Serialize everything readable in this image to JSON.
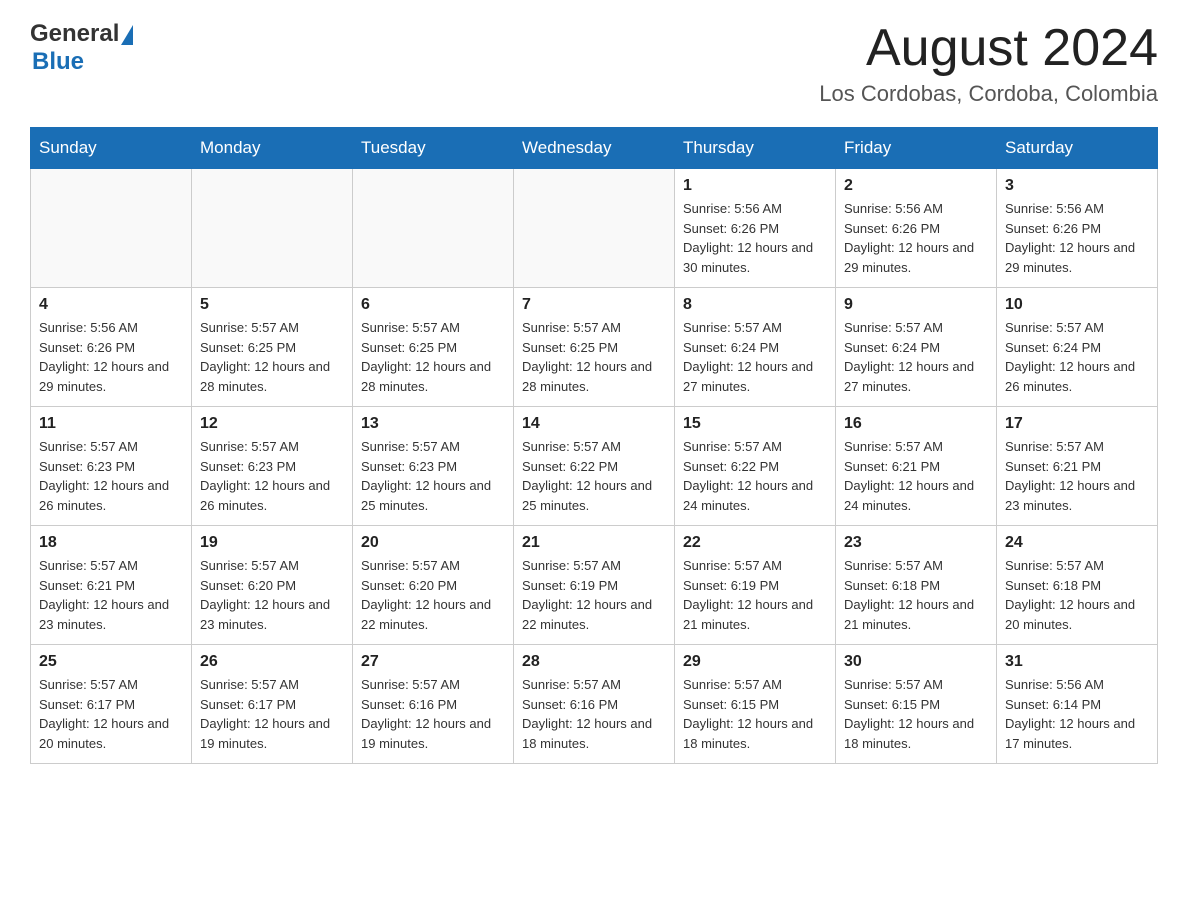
{
  "header": {
    "logo": {
      "general": "General",
      "blue": "Blue"
    },
    "title": "August 2024",
    "location": "Los Cordobas, Cordoba, Colombia"
  },
  "days_of_week": [
    "Sunday",
    "Monday",
    "Tuesday",
    "Wednesday",
    "Thursday",
    "Friday",
    "Saturday"
  ],
  "weeks": [
    [
      {
        "day": "",
        "info": ""
      },
      {
        "day": "",
        "info": ""
      },
      {
        "day": "",
        "info": ""
      },
      {
        "day": "",
        "info": ""
      },
      {
        "day": "1",
        "info": "Sunrise: 5:56 AM\nSunset: 6:26 PM\nDaylight: 12 hours and 30 minutes."
      },
      {
        "day": "2",
        "info": "Sunrise: 5:56 AM\nSunset: 6:26 PM\nDaylight: 12 hours and 29 minutes."
      },
      {
        "day": "3",
        "info": "Sunrise: 5:56 AM\nSunset: 6:26 PM\nDaylight: 12 hours and 29 minutes."
      }
    ],
    [
      {
        "day": "4",
        "info": "Sunrise: 5:56 AM\nSunset: 6:26 PM\nDaylight: 12 hours and 29 minutes."
      },
      {
        "day": "5",
        "info": "Sunrise: 5:57 AM\nSunset: 6:25 PM\nDaylight: 12 hours and 28 minutes."
      },
      {
        "day": "6",
        "info": "Sunrise: 5:57 AM\nSunset: 6:25 PM\nDaylight: 12 hours and 28 minutes."
      },
      {
        "day": "7",
        "info": "Sunrise: 5:57 AM\nSunset: 6:25 PM\nDaylight: 12 hours and 28 minutes."
      },
      {
        "day": "8",
        "info": "Sunrise: 5:57 AM\nSunset: 6:24 PM\nDaylight: 12 hours and 27 minutes."
      },
      {
        "day": "9",
        "info": "Sunrise: 5:57 AM\nSunset: 6:24 PM\nDaylight: 12 hours and 27 minutes."
      },
      {
        "day": "10",
        "info": "Sunrise: 5:57 AM\nSunset: 6:24 PM\nDaylight: 12 hours and 26 minutes."
      }
    ],
    [
      {
        "day": "11",
        "info": "Sunrise: 5:57 AM\nSunset: 6:23 PM\nDaylight: 12 hours and 26 minutes."
      },
      {
        "day": "12",
        "info": "Sunrise: 5:57 AM\nSunset: 6:23 PM\nDaylight: 12 hours and 26 minutes."
      },
      {
        "day": "13",
        "info": "Sunrise: 5:57 AM\nSunset: 6:23 PM\nDaylight: 12 hours and 25 minutes."
      },
      {
        "day": "14",
        "info": "Sunrise: 5:57 AM\nSunset: 6:22 PM\nDaylight: 12 hours and 25 minutes."
      },
      {
        "day": "15",
        "info": "Sunrise: 5:57 AM\nSunset: 6:22 PM\nDaylight: 12 hours and 24 minutes."
      },
      {
        "day": "16",
        "info": "Sunrise: 5:57 AM\nSunset: 6:21 PM\nDaylight: 12 hours and 24 minutes."
      },
      {
        "day": "17",
        "info": "Sunrise: 5:57 AM\nSunset: 6:21 PM\nDaylight: 12 hours and 23 minutes."
      }
    ],
    [
      {
        "day": "18",
        "info": "Sunrise: 5:57 AM\nSunset: 6:21 PM\nDaylight: 12 hours and 23 minutes."
      },
      {
        "day": "19",
        "info": "Sunrise: 5:57 AM\nSunset: 6:20 PM\nDaylight: 12 hours and 23 minutes."
      },
      {
        "day": "20",
        "info": "Sunrise: 5:57 AM\nSunset: 6:20 PM\nDaylight: 12 hours and 22 minutes."
      },
      {
        "day": "21",
        "info": "Sunrise: 5:57 AM\nSunset: 6:19 PM\nDaylight: 12 hours and 22 minutes."
      },
      {
        "day": "22",
        "info": "Sunrise: 5:57 AM\nSunset: 6:19 PM\nDaylight: 12 hours and 21 minutes."
      },
      {
        "day": "23",
        "info": "Sunrise: 5:57 AM\nSunset: 6:18 PM\nDaylight: 12 hours and 21 minutes."
      },
      {
        "day": "24",
        "info": "Sunrise: 5:57 AM\nSunset: 6:18 PM\nDaylight: 12 hours and 20 minutes."
      }
    ],
    [
      {
        "day": "25",
        "info": "Sunrise: 5:57 AM\nSunset: 6:17 PM\nDaylight: 12 hours and 20 minutes."
      },
      {
        "day": "26",
        "info": "Sunrise: 5:57 AM\nSunset: 6:17 PM\nDaylight: 12 hours and 19 minutes."
      },
      {
        "day": "27",
        "info": "Sunrise: 5:57 AM\nSunset: 6:16 PM\nDaylight: 12 hours and 19 minutes."
      },
      {
        "day": "28",
        "info": "Sunrise: 5:57 AM\nSunset: 6:16 PM\nDaylight: 12 hours and 18 minutes."
      },
      {
        "day": "29",
        "info": "Sunrise: 5:57 AM\nSunset: 6:15 PM\nDaylight: 12 hours and 18 minutes."
      },
      {
        "day": "30",
        "info": "Sunrise: 5:57 AM\nSunset: 6:15 PM\nDaylight: 12 hours and 18 minutes."
      },
      {
        "day": "31",
        "info": "Sunrise: 5:56 AM\nSunset: 6:14 PM\nDaylight: 12 hours and 17 minutes."
      }
    ]
  ]
}
